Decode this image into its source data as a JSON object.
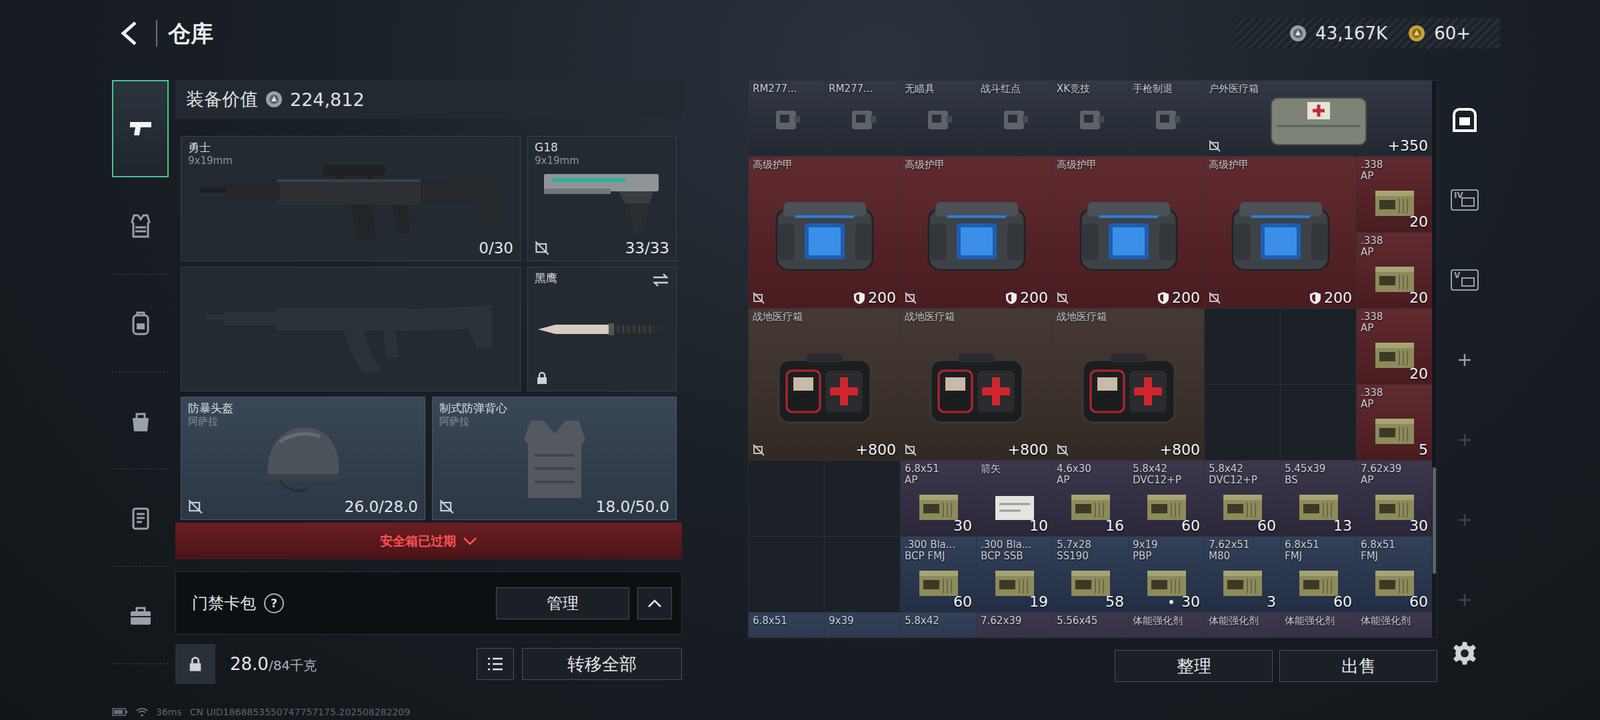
{
  "header": {
    "title": "仓库",
    "currency": "43,167K",
    "tokens": "60+"
  },
  "nav": [
    {
      "kind": "weapon",
      "selected": true
    },
    {
      "kind": "vest",
      "selected": false
    },
    {
      "kind": "backpack",
      "selected": false
    },
    {
      "kind": "bag",
      "selected": false
    },
    {
      "kind": "case",
      "selected": false
    },
    {
      "kind": "toolbox",
      "selected": false
    }
  ],
  "equipment": {
    "label": "装备价值",
    "value": "224,812",
    "slots": [
      {
        "kind": "rifle",
        "name": "勇士",
        "caliber": "9x19mm",
        "ammo": "0/30",
        "bound": false
      },
      {
        "kind": "pistol",
        "name": "G18",
        "caliber": "9x19mm",
        "ammo": "33/33",
        "bound": true
      },
      {
        "kind": "empty"
      },
      {
        "kind": "knife",
        "name": "黑鹰",
        "locked": true
      },
      {
        "kind": "helmet",
        "name": "防暴头盔",
        "maker": "阿萨拉",
        "durability": "26.0/28.0",
        "bound": true
      },
      {
        "kind": "vest",
        "name": "制式防弹背心",
        "maker": "阿萨拉",
        "durability": "18.0/50.0",
        "bound": true
      }
    ]
  },
  "safe_box": {
    "label": "安全箱已过期",
    "expired": true
  },
  "card_pack": {
    "label": "门禁卡包",
    "help": "?",
    "button": "管理",
    "expanded": false
  },
  "weight": {
    "current": "28.0",
    "max": "/84千克"
  },
  "transfer": "转移全部",
  "inventory": {
    "items": [
      {
        "kind": "attachment",
        "name": "RM277...",
        "color": "#2a303d",
        "span": [
          1,
          1
        ],
        "bound": false,
        "marked": false
      },
      {
        "kind": "attachment",
        "name": "RM277...",
        "color": "#2a303d",
        "span": [
          1,
          1
        ],
        "bound": false,
        "marked": false
      },
      {
        "kind": "attachment",
        "name": "无瞄具",
        "color": "#2a303d",
        "span": [
          1,
          1
        ],
        "bound": false,
        "marked": false
      },
      {
        "kind": "attachment",
        "name": "战斗红点",
        "color": "#2a303d",
        "span": [
          1,
          1
        ],
        "bound": false,
        "marked": false
      },
      {
        "kind": "attachment",
        "name": "XK竞技",
        "color": "#2a303d",
        "span": [
          1,
          1
        ],
        "bound": false,
        "marked": false
      },
      {
        "kind": "attachment",
        "name": "手枪制退",
        "color": "#2a303d",
        "span": [
          1,
          1
        ],
        "bound": false,
        "marked": false
      },
      {
        "kind": "medbag",
        "name": "户外医疗箱",
        "count": "+350",
        "color": "#2a303d",
        "span": [
          3,
          1
        ],
        "bound": true,
        "marked": false
      },
      {
        "kind": "armor",
        "name": "高级护甲",
        "count": "200",
        "color": "#5a2227",
        "span": [
          2,
          2
        ],
        "bound": true,
        "marked": false
      },
      {
        "kind": "armor",
        "name": "高级护甲",
        "count": "200",
        "color": "#5a2227",
        "span": [
          2,
          2
        ],
        "bound": true,
        "marked": false
      },
      {
        "kind": "armor",
        "name": "高级护甲",
        "count": "200",
        "color": "#5a2227",
        "span": [
          2,
          2
        ],
        "bound": true,
        "marked": false
      },
      {
        "kind": "armor",
        "name": "高级护甲",
        "count": "200",
        "color": "#5a2227",
        "span": [
          2,
          2
        ],
        "bound": true,
        "marked": false
      },
      {
        "kind": "ammo",
        "name": ".338",
        "sub": "AP",
        "count": "20",
        "color": "#5a2227",
        "span": [
          1,
          1
        ],
        "bound": false,
        "marked": false
      },
      {
        "kind": "ammo",
        "name": ".338",
        "sub": "AP",
        "count": "20",
        "color": "#5a2227",
        "span": [
          1,
          1
        ],
        "bound": false,
        "marked": false
      },
      {
        "kind": "medkit",
        "name": "战地医疗箱",
        "count": "+800",
        "color": "#3e322b",
        "span": [
          2,
          2
        ],
        "bound": true,
        "marked": false
      },
      {
        "kind": "medkit",
        "name": "战地医疗箱",
        "count": "+800",
        "color": "#3e322b",
        "span": [
          2,
          2
        ],
        "bound": true,
        "marked": false
      },
      {
        "kind": "medkit",
        "name": "战地医疗箱",
        "count": "+800",
        "color": "#3e322b",
        "span": [
          2,
          2
        ],
        "bound": true,
        "marked": false
      },
      {
        "kind": "empty"
      },
      {
        "kind": "empty"
      },
      {
        "kind": "ammo",
        "name": ".338",
        "sub": "AP",
        "count": "20",
        "color": "#5a2227",
        "span": [
          1,
          1
        ],
        "bound": false,
        "marked": false
      },
      {
        "kind": "empty"
      },
      {
        "kind": "empty"
      },
      {
        "kind": "ammo",
        "name": ".338",
        "sub": "AP",
        "count": "5",
        "color": "#5a2227",
        "span": [
          1,
          1
        ],
        "bound": false,
        "marked": false
      },
      {
        "kind": "empty"
      },
      {
        "kind": "empty"
      },
      {
        "kind": "ammo",
        "name": "6.8x51",
        "sub": "AP",
        "count": "30",
        "color": "#352f45",
        "span": [
          1,
          1
        ],
        "bound": false,
        "marked": false
      },
      {
        "kind": "arrow",
        "name": "箭矢",
        "count": "10",
        "color": "#352f45",
        "span": [
          1,
          1
        ],
        "bound": false,
        "marked": false
      },
      {
        "kind": "ammo",
        "name": "4.6x30",
        "sub": "AP",
        "count": "16",
        "color": "#352f45",
        "span": [
          1,
          1
        ],
        "bound": false,
        "marked": false
      },
      {
        "kind": "ammo",
        "name": "5.8x42",
        "sub": "DVC12+P",
        "count": "60",
        "color": "#352f45",
        "span": [
          1,
          1
        ],
        "bound": false,
        "marked": false
      },
      {
        "kind": "ammo",
        "name": "5.8x42",
        "sub": "DVC12+P",
        "count": "60",
        "color": "#352f45",
        "span": [
          1,
          1
        ],
        "bound": false,
        "marked": false
      },
      {
        "kind": "ammo",
        "name": "5.45x39",
        "sub": "BS",
        "count": "13",
        "color": "#352f45",
        "span": [
          1,
          1
        ],
        "bound": false,
        "marked": false
      },
      {
        "kind": "ammo",
        "name": "7.62x39",
        "sub": "AP",
        "count": "30",
        "color": "#352f45",
        "span": [
          1,
          1
        ],
        "bound": false,
        "marked": false
      },
      {
        "kind": "empty"
      },
      {
        "kind": "empty"
      },
      {
        "kind": "ammo",
        "name": ".300 Bla...",
        "sub": "BCP FMJ",
        "count": "60",
        "color": "#2a3852",
        "span": [
          1,
          1
        ],
        "bound": false,
        "marked": false
      },
      {
        "kind": "ammo",
        "name": ".300 Bla...",
        "sub": "BCP SSB",
        "count": "19",
        "color": "#2a3852",
        "span": [
          1,
          1
        ],
        "bound": false,
        "marked": false
      },
      {
        "kind": "ammo",
        "name": "5.7x28",
        "sub": "SS190",
        "count": "58",
        "color": "#2a3852",
        "span": [
          1,
          1
        ],
        "bound": false,
        "marked": false
      },
      {
        "kind": "ammo",
        "name": "9x19",
        "sub": "PBP",
        "count": "30",
        "color": "#2a3852",
        "span": [
          1,
          1
        ],
        "bound": false,
        "marked": true
      },
      {
        "kind": "ammo",
        "name": "7.62x51",
        "sub": "M80",
        "count": "3",
        "color": "#2a3852",
        "span": [
          1,
          1
        ],
        "bound": false,
        "marked": false
      },
      {
        "kind": "ammo",
        "name": "6.8x51",
        "sub": "FMJ",
        "count": "60",
        "color": "#2a3852",
        "span": [
          1,
          1
        ],
        "bound": false,
        "marked": false
      },
      {
        "kind": "ammo",
        "name": "6.8x51",
        "sub": "FMJ",
        "count": "60",
        "color": "#2a3852",
        "span": [
          1,
          1
        ],
        "bound": false,
        "marked": false
      },
      {
        "kind": "ammo",
        "name": "6.8x51",
        "color": "#2a3852",
        "span": [
          1,
          1
        ],
        "bound": false,
        "marked": false
      },
      {
        "kind": "ammo",
        "name": "9x39",
        "color": "#2a3852",
        "span": [
          1,
          1
        ],
        "bound": false,
        "marked": false
      },
      {
        "kind": "ammo",
        "name": "5.8x42",
        "color": "#2a3852",
        "span": [
          1,
          1
        ],
        "bound": false,
        "marked": false
      },
      {
        "kind": "ammo",
        "name": "7.62x39",
        "color": "#352f45",
        "span": [
          1,
          1
        ],
        "bound": false,
        "marked": false
      },
      {
        "kind": "ammo",
        "name": "5.56x45",
        "color": "#352f45",
        "span": [
          1,
          1
        ],
        "bound": false,
        "marked": false
      },
      {
        "kind": "stim",
        "name": "体能强化剂",
        "color": "#352f45",
        "span": [
          1,
          1
        ],
        "bound": false,
        "marked": false
      },
      {
        "kind": "stim",
        "name": "体能强化剂",
        "color": "#352f45",
        "span": [
          1,
          1
        ],
        "bound": false,
        "marked": false
      },
      {
        "kind": "stim",
        "name": "体能强化剂",
        "color": "#352f45",
        "span": [
          1,
          1
        ],
        "bound": false,
        "marked": false
      },
      {
        "kind": "stim",
        "name": "体能强化剂",
        "color": "#352f45",
        "span": [
          1,
          1
        ],
        "bound": false,
        "marked": false
      }
    ],
    "buttons": [
      "整理",
      "出售"
    ]
  },
  "side": [
    {
      "kind": "safe",
      "selected": true,
      "disabled": false
    },
    {
      "kind": "card",
      "label": "IV",
      "selected": false,
      "disabled": false
    },
    {
      "kind": "card",
      "label": "V",
      "selected": false,
      "disabled": false
    },
    {
      "kind": "add",
      "selected": false,
      "disabled": false
    },
    {
      "kind": "add",
      "selected": false,
      "disabled": true
    },
    {
      "kind": "add",
      "selected": false,
      "disabled": true
    },
    {
      "kind": "add",
      "selected": false,
      "disabled": true
    },
    {
      "kind": "settings",
      "selected": false,
      "disabled": false
    }
  ],
  "footer": {
    "ping": "36ms",
    "uid": "CN UID1868853550747757175.202508282209"
  }
}
